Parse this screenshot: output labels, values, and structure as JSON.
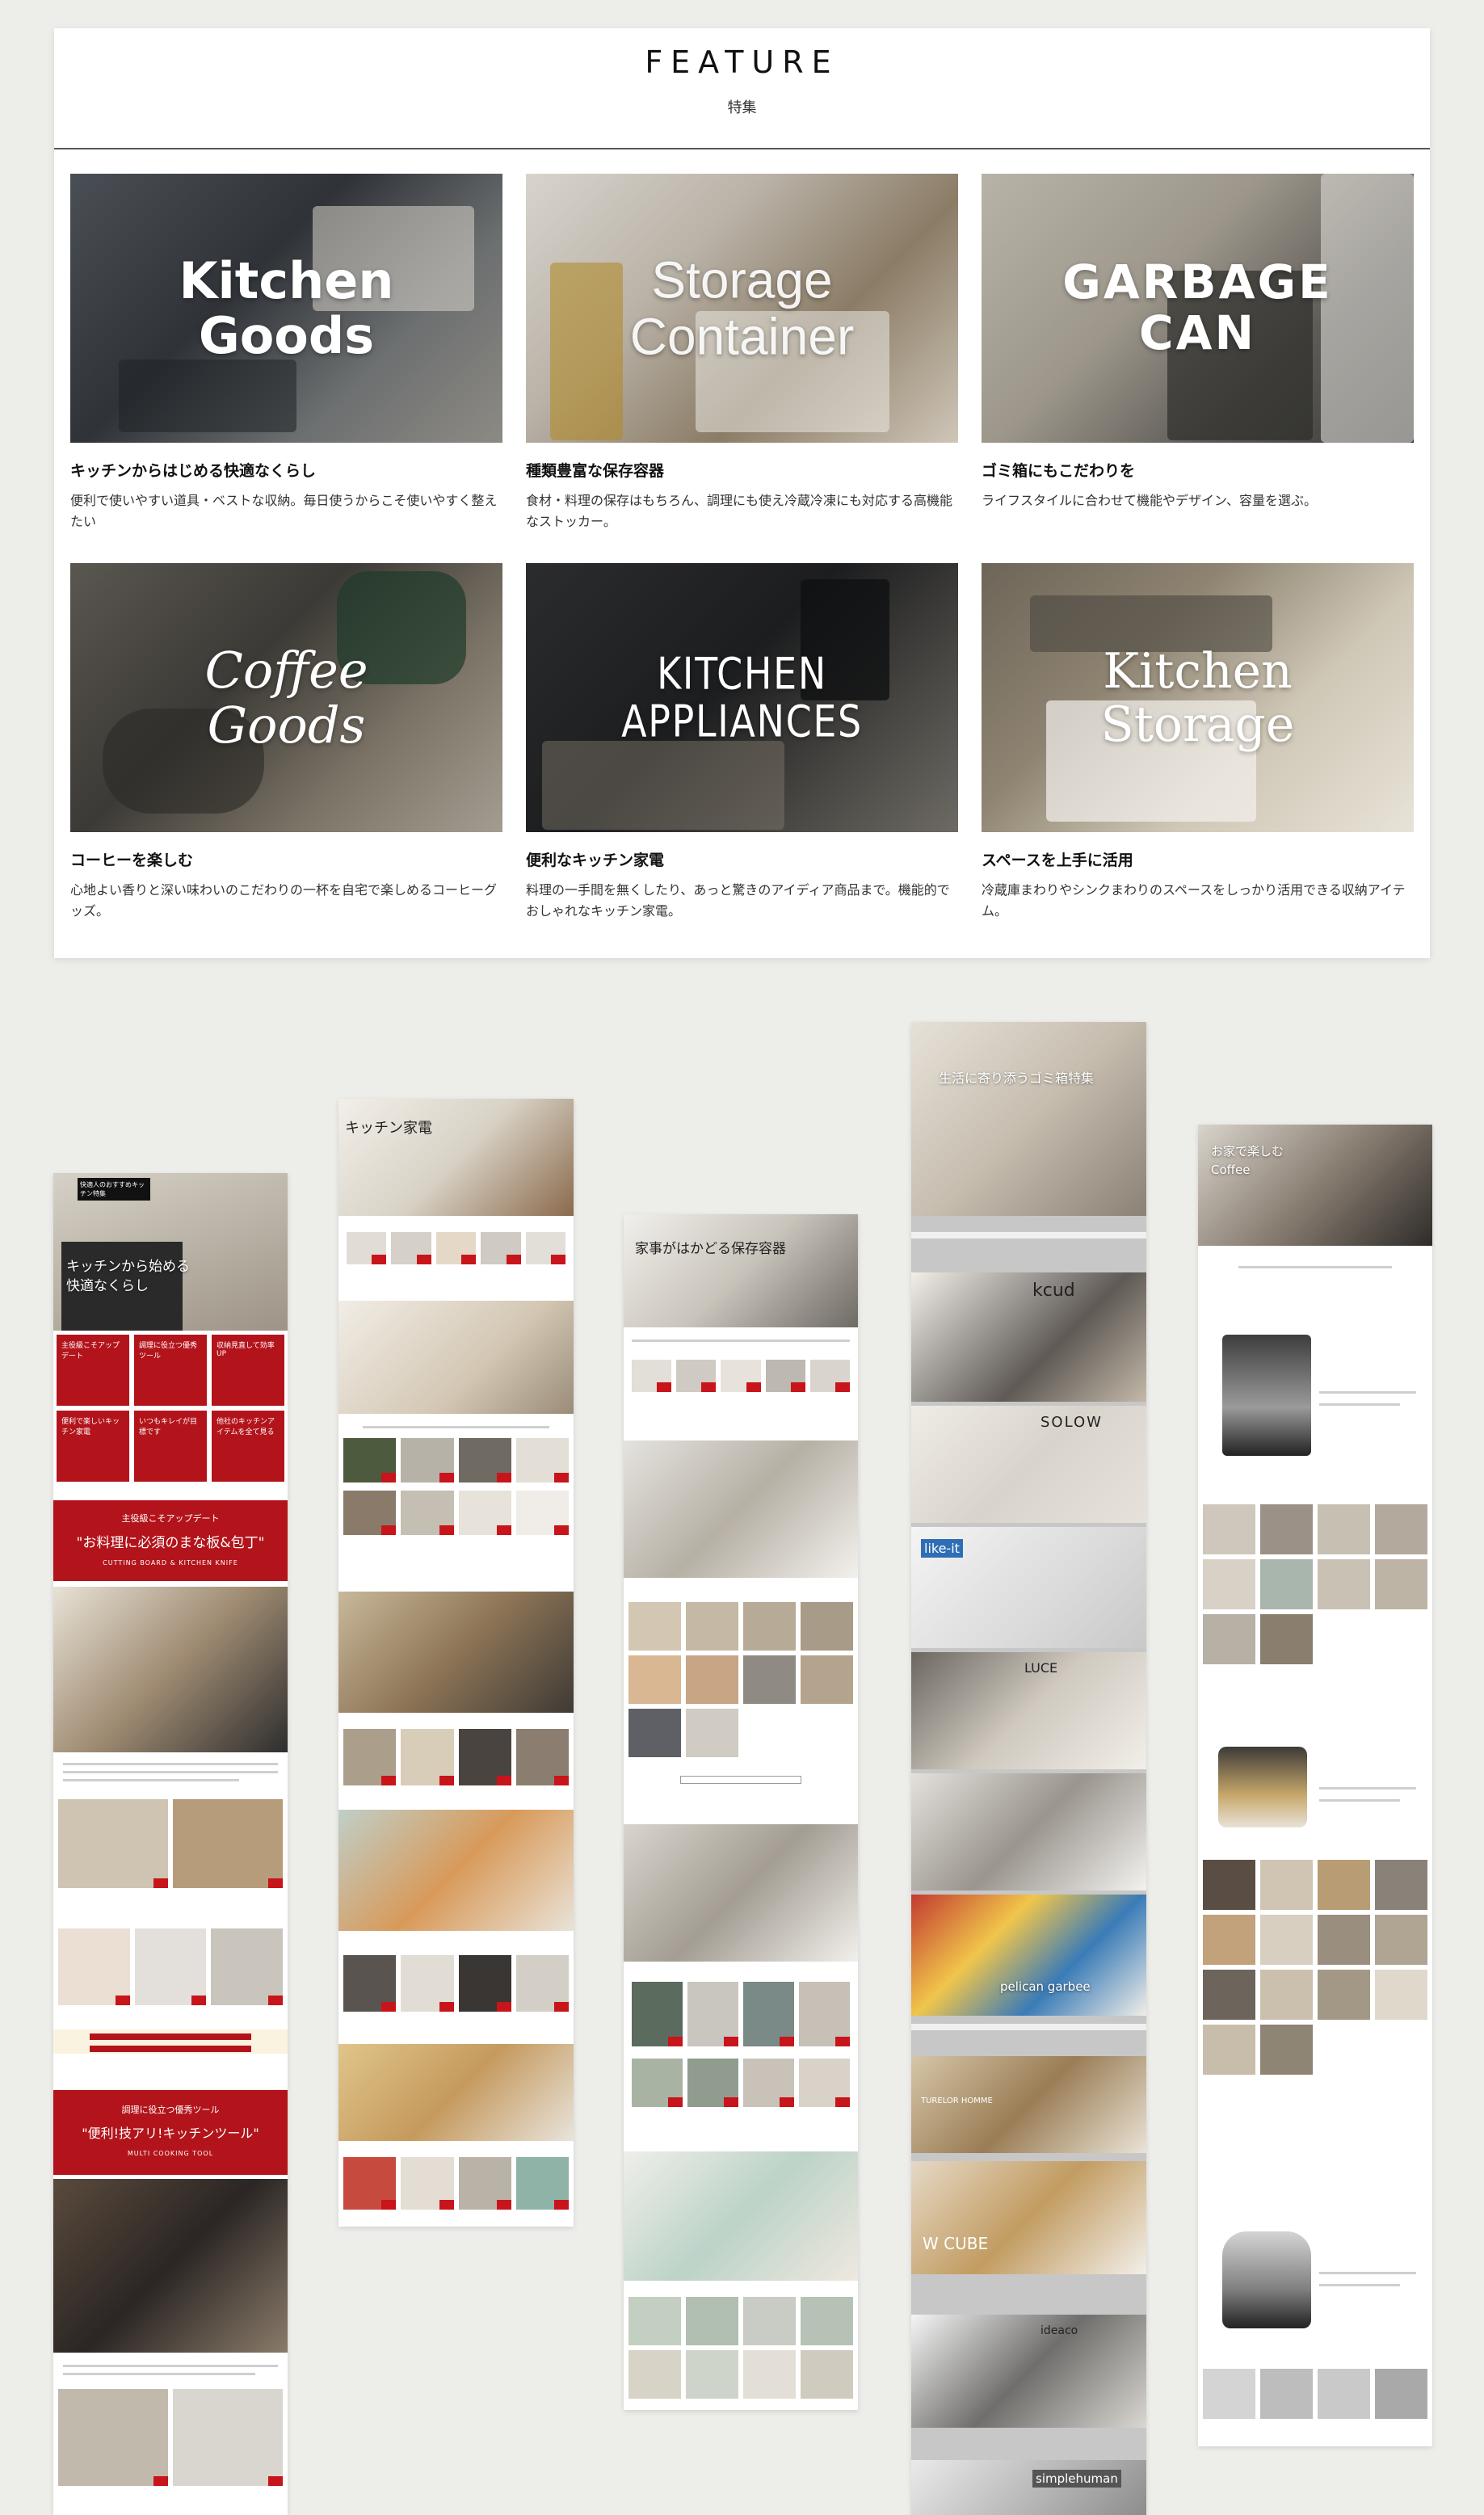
{
  "feature": {
    "title": "FEATURE",
    "subtitle": "特集",
    "items": [
      {
        "overlay": "Kitchen\nGoods",
        "name": "キッチンからはじめる快適なくらし",
        "desc": "便利で使いやすい道具・ベストな収納。毎日使うからこそ使いやすく整えたい"
      },
      {
        "overlay": "Storage\nContainer",
        "name": "種類豊富な保存容器",
        "desc": "食材・料理の保存はもちろん、調理にも使え冷蔵冷凍にも対応する高機能なストッカー。"
      },
      {
        "overlay": "GARBAGE\nCAN",
        "name": "ゴミ箱にもこだわりを",
        "desc": "ライフスタイルに合わせて機能やデザイン、容量を選ぶ。"
      },
      {
        "overlay": "Coffee\nGoods",
        "name": "コーヒーを楽しむ",
        "desc": "心地よい香りと深い味わいのこだわりの一杯を自宅で楽しめるコーヒーグッズ。"
      },
      {
        "overlay": "KITCHEN\nAPPLIANCES",
        "name": "便利なキッチン家電",
        "desc": "料理の一手間を無くしたり、あっと驚きのアイディア商品まで。機能的でおしゃれなキッチン家電。"
      },
      {
        "overlay": "Kitchen\nStorage",
        "name": "スペースを上手に活用",
        "desc": "冷蔵庫まわりやシンクまわりのスペースをしっかり活用できる収納アイテム。"
      }
    ]
  },
  "thumbs": {
    "kitchen_page": {
      "hero": "キッチンから始める\n快適なくらし",
      "badge": "快適人のおすすめキッチン特集",
      "banner1_sub": "主役級こそアップデート",
      "banner1_title": "\"お料理に必須のまな板&包丁\"",
      "banner1_en": "CUTTING BOARD & KITCHEN KNIFE",
      "banner2_sub": "調理に役立つ優秀ツール",
      "banner2_title": "\"便利!技アリ!キッチンツール\"",
      "banner2_en": "MULTI COOKING TOOL",
      "tiles": [
        "主役級こそアップデート",
        "調理に役立つ優秀ツール",
        "収納見直して効率UP",
        "便利で楽しいキッチン家電",
        "いつもキレイが目標です",
        "他社のキッチンアイテムを全て見る"
      ]
    },
    "appliance_page": {
      "hero": "キッチン家電"
    },
    "storage_page": {
      "hero": "家事がはかどる保存容器"
    },
    "garbage_page": {
      "hero": "生活に寄り添うゴミ箱特集",
      "brands": [
        "kcud",
        "SOLOW",
        "like-it",
        "LUCE",
        "pelican garbee",
        "TURELOR HOMME",
        "W CUBE",
        "ideaco",
        "simplehuman"
      ]
    },
    "coffee_page": {
      "hero": "お家で楽しむ\nCoffee"
    }
  }
}
